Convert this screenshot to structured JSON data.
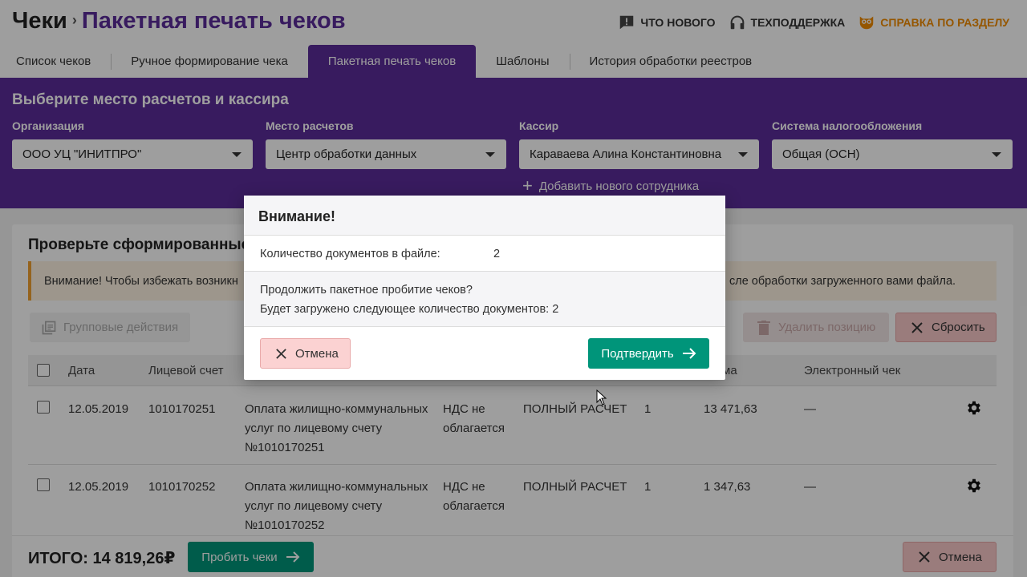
{
  "header": {
    "breadcrumb_root": "Чеки",
    "breadcrumb_sep": "›",
    "page_title": "Пакетная печать чеков",
    "links": {
      "whats_new": "ЧТО НОВОГО",
      "support": "ТЕХПОДДЕРЖКА",
      "help": "СПРАВКА ПО РАЗДЕЛУ"
    }
  },
  "tabs": [
    {
      "label": "Список чеков"
    },
    {
      "label": "Ручное формирование чека"
    },
    {
      "label": "Пакетная печать чеков"
    },
    {
      "label": "Шаблоны"
    },
    {
      "label": "История обработки реестров"
    }
  ],
  "settings": {
    "title": "Выберите место расчетов и кассира",
    "organization": {
      "label": "Организация",
      "value": "ООО УЦ \"ИНИТПРО\""
    },
    "place": {
      "label": "Место расчетов",
      "value": "Центр обработки данных"
    },
    "cashier": {
      "label": "Кассир",
      "value": "Караваева Алина Константиновна"
    },
    "tax": {
      "label": "Система налогообложения",
      "value": "Общая (ОСН)"
    },
    "add_employee": "Добавить нового сотрудника"
  },
  "main": {
    "title": "Проверьте сформированные",
    "warning_start": "Внимание! Чтобы избежать возникн",
    "warning_end": "сле обработки загруженного вами файла.",
    "group_actions": "Групповые действия",
    "delete_position": "Удалить позицию",
    "reset": "Сбросить"
  },
  "table": {
    "headers": {
      "date": "Дата",
      "account": "Лицевой счет",
      "sum": "ма",
      "ereceipt": "Электронный чек"
    },
    "rows": [
      {
        "date": "12.05.2019",
        "account": "1010170251",
        "desc_l1": "Оплата жилищно-коммунальных",
        "desc_l2": "услуг по лицевому счету",
        "desc_l3": "№1010170251",
        "vat_l1": "НДС не",
        "vat_l2": "облагается",
        "payment": "ПОЛНЫЙ РАСЧЕТ",
        "qty": "1",
        "sum": "13 471,63",
        "ereceipt": "—"
      },
      {
        "date": "12.05.2019",
        "account": "1010170252",
        "desc_l1": "Оплата жилищно-коммунальных",
        "desc_l2": "услуг по лицевому счету",
        "desc_l3": "№1010170252",
        "vat_l1": "НДС не",
        "vat_l2": "облагается",
        "payment": "ПОЛНЫЙ РАСЧЕТ",
        "qty": "1",
        "sum": "1 347,63",
        "ereceipt": "—"
      }
    ]
  },
  "footer": {
    "total": "ИТОГО: 14 819,26₽",
    "print_button": "Пробить чеки",
    "cancel_button": "Отмена"
  },
  "modal": {
    "title": "Внимание!",
    "docs_label": "Количество документов в файле:",
    "docs_value": "2",
    "question": "Продолжить пакетное пробитие чеков?",
    "info": "Будет загружено следующее количество документов: 2",
    "cancel": "Отмена",
    "confirm": "Подтвердить"
  },
  "colors": {
    "brand_purple": "#5b2c9a",
    "confirm_green": "#00957a",
    "cancel_red_bg": "#fbd2d2",
    "help_orange": "#f08c00"
  }
}
